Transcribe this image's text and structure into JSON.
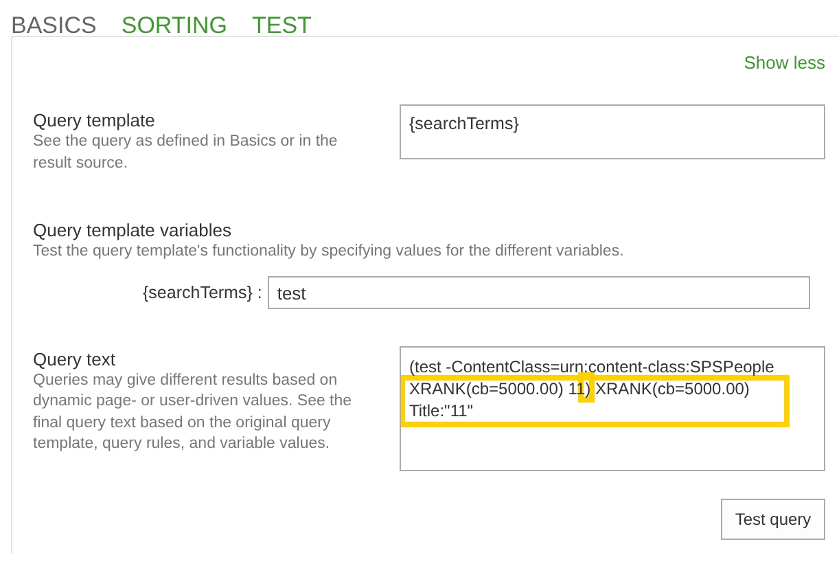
{
  "tabs": [
    {
      "label": "BASICS",
      "selected": true
    },
    {
      "label": "SORTING",
      "selected": false
    },
    {
      "label": "TEST",
      "selected": false
    }
  ],
  "show_less": "Show less",
  "query_template": {
    "label": "Query template",
    "description": "See the query as defined in Basics or in the result source.",
    "value": "{searchTerms}"
  },
  "query_template_variables": {
    "label": "Query template variables",
    "description": "Test the query template's functionality by specifying values for the different variables.",
    "variables": [
      {
        "name": "{searchTerms} :",
        "value": "test"
      }
    ]
  },
  "query_text": {
    "label": "Query text",
    "description": "Queries may give different results based on dynamic page- or user-driven values. See the final query text based on the original query template, query rules, and variable values.",
    "lines": [
      "(test -ContentClass=urn:content-class:SPSPeople",
      "XRANK(cb=5000.00) 11) XRANK(cb=5000.00)",
      "Title:\"11\""
    ]
  },
  "highlights": {
    "lines": true,
    "paren": true
  },
  "test_button": "Test query"
}
